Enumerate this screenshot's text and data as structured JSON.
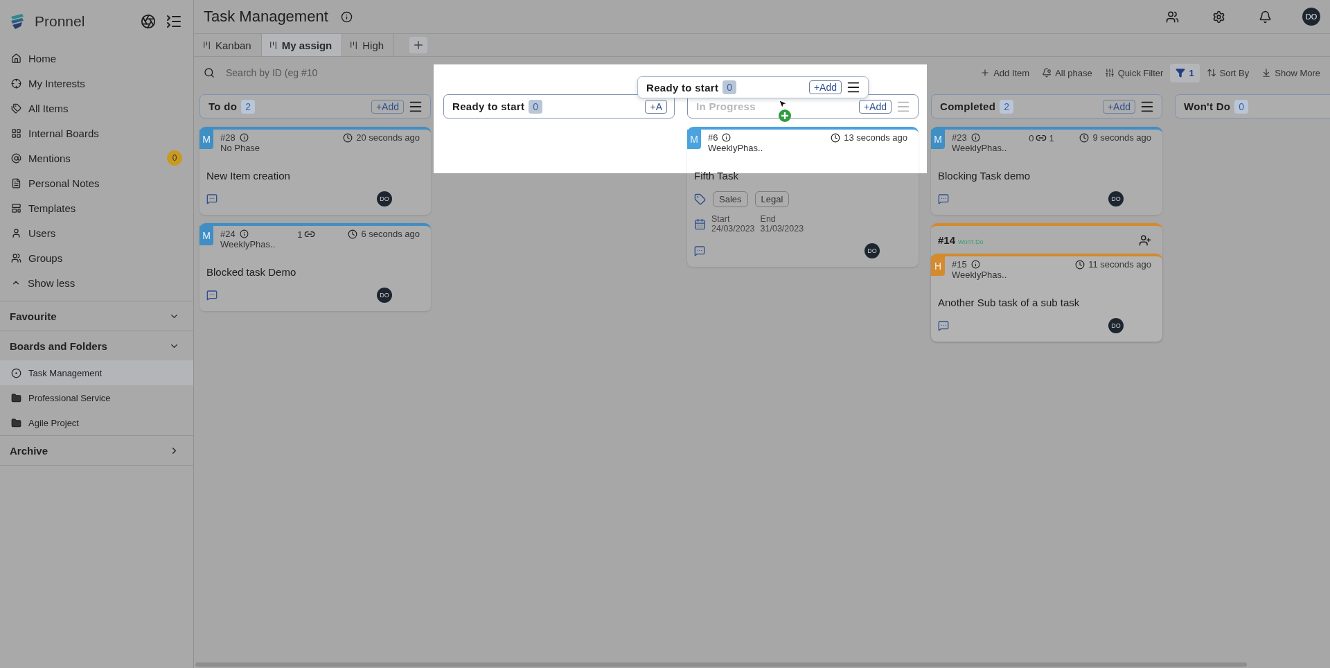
{
  "sidebar": {
    "brand": "Pronnel",
    "nav": [
      {
        "label": "Home"
      },
      {
        "label": "My Interests"
      },
      {
        "label": "All Items"
      },
      {
        "label": "Internal Boards"
      },
      {
        "label": "Mentions",
        "badge": "0"
      },
      {
        "label": "Personal Notes"
      },
      {
        "label": "Templates"
      },
      {
        "label": "Users"
      },
      {
        "label": "Groups"
      }
    ],
    "show_less": "Show less",
    "sections": [
      {
        "title": "Favourite",
        "expanded": true
      },
      {
        "title": "Boards and Folders",
        "expanded": true,
        "items": [
          {
            "label": "Task Management",
            "kind": "board",
            "selected": true
          },
          {
            "label": "Professional Service",
            "kind": "folder",
            "selected": false
          },
          {
            "label": "Agile Project",
            "kind": "folder",
            "selected": false
          }
        ]
      },
      {
        "title": "Archive",
        "expanded": false
      }
    ]
  },
  "header": {
    "title": "Task Management",
    "avatar": "DO"
  },
  "tabs": [
    {
      "label": "Kanban",
      "selected": false
    },
    {
      "label": "My assign",
      "selected": true
    },
    {
      "label": "High",
      "selected": false
    }
  ],
  "toolbar": {
    "search_placeholder": "Search by ID (eg #10",
    "actions": [
      {
        "kind": "add",
        "label": "Add Item"
      },
      {
        "kind": "phase",
        "label": "All phase"
      },
      {
        "kind": "quick",
        "label": "Quick Filter"
      },
      {
        "kind": "filter",
        "label": "1"
      },
      {
        "kind": "sort",
        "label": "Sort By"
      },
      {
        "kind": "more",
        "label": "Show More"
      }
    ]
  },
  "columns": [
    {
      "title": "To do",
      "count": "2",
      "add": "+Add",
      "menu": true,
      "faded": false,
      "cards": [
        {
          "kind": "task",
          "id": "#28",
          "priority": "M",
          "color": "#3f8ec4",
          "phase": "No Phase",
          "time": "20 seconds ago",
          "title": "New Item creation",
          "avatar": "DO"
        },
        {
          "kind": "task",
          "id": "#24",
          "priority": "M",
          "color": "#3f8ec4",
          "phase": "WeeklyPhas..",
          "time": "6 seconds ago",
          "title": "Blocked task Demo",
          "avatar": "DO",
          "links": {
            "before": "1"
          }
        }
      ]
    },
    {
      "title": "Ready to start",
      "count": "0",
      "add": "+A",
      "menu": false,
      "faded": false
    },
    {
      "title": "In Progress",
      "add": "+Add",
      "menu": true,
      "faded": true,
      "cards": [
        {
          "kind": "task",
          "id": "#6",
          "priority": "M",
          "color": "#4aa3df",
          "phase": "WeeklyPhas..",
          "time": "13 seconds ago",
          "title": "Fifth Task",
          "avatar": "DO",
          "tags": [
            "Sales",
            "Legal"
          ],
          "dates": {
            "start_label": "Start",
            "start": "24/03/2023",
            "end_label": "End",
            "end": "31/03/2023"
          }
        }
      ]
    },
    {
      "title": "Completed",
      "count": "2",
      "add": "+Add",
      "menu": true,
      "faded": false,
      "cards": [
        {
          "kind": "task",
          "id": "#23",
          "priority": "M",
          "color": "#3f8ec4",
          "phase": "WeeklyPhas..",
          "time": "9 seconds ago",
          "title": "Blocking Task demo",
          "avatar": "DO",
          "links": {
            "before": "0",
            "after": "1"
          }
        },
        {
          "kind": "group",
          "id": "#14",
          "status": "Won't Do",
          "color": "#d58a2c",
          "children": [
            {
              "kind": "task",
              "id": "#15",
              "priority": "H",
              "color": "#d58a2c",
              "phase": "WeeklyPhas..",
              "time": "11 seconds ago",
              "title": "Another Sub task of a sub task",
              "avatar": "DO"
            }
          ]
        }
      ]
    },
    {
      "title": "Won't Do",
      "count": "0",
      "menu": false,
      "faded": false
    }
  ],
  "drag_preview": {
    "title": "Ready to start",
    "count": "0",
    "add": "+Add"
  }
}
